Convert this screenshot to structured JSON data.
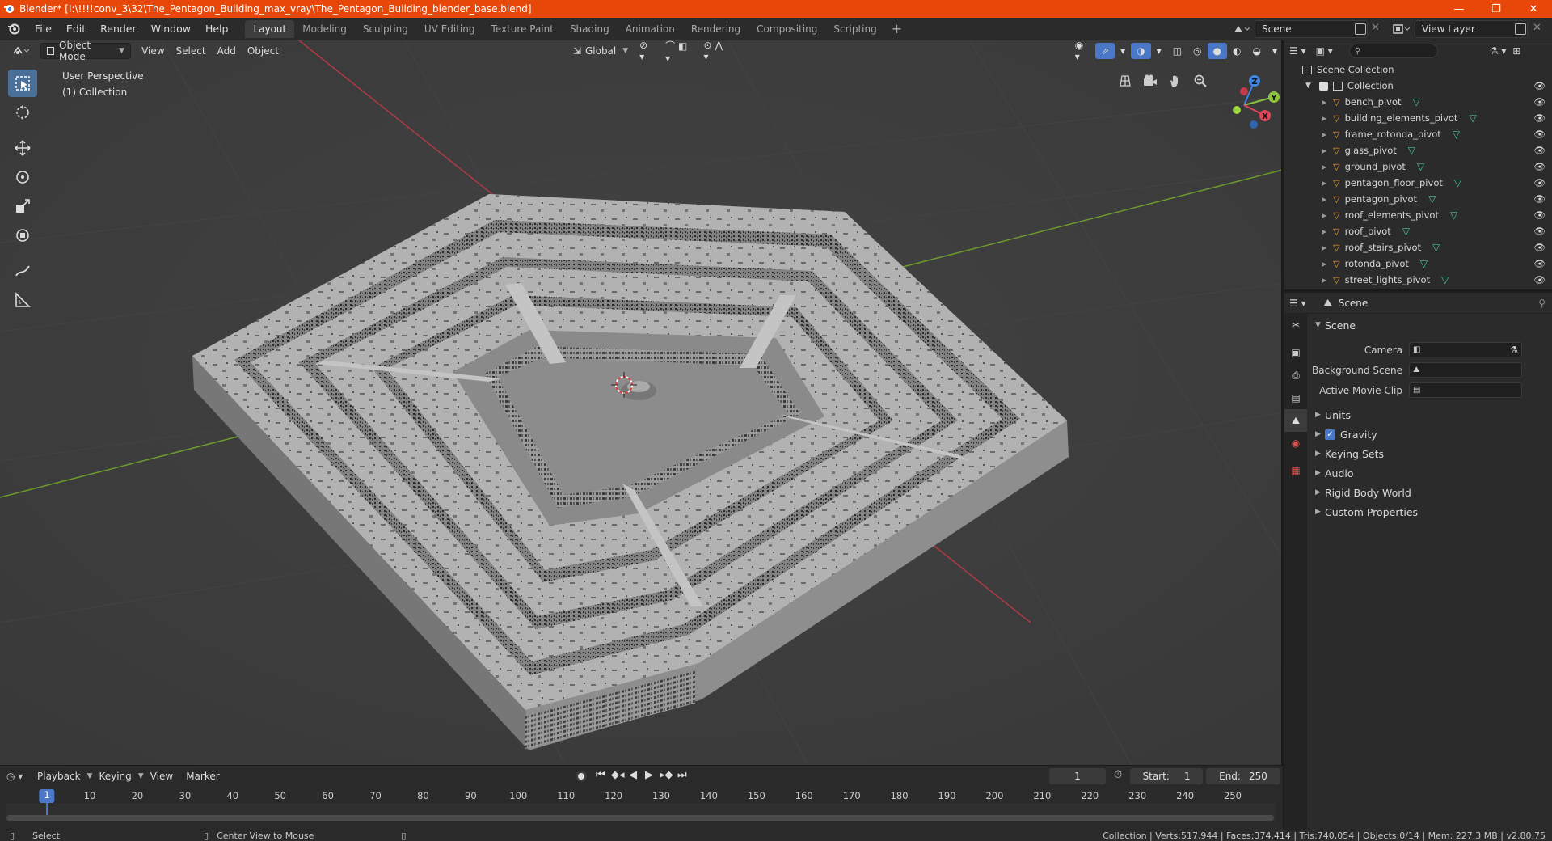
{
  "window": {
    "title": "Blender* [I:\\!!!!conv_3\\32\\The_Pentagon_Building_max_vray\\The_Pentagon_Building_blender_base.blend]",
    "minimize": "—",
    "maximize": "❐",
    "close": "✕"
  },
  "menubar": {
    "items": [
      "File",
      "Edit",
      "Render",
      "Window",
      "Help"
    ],
    "workspaces": [
      "Layout",
      "Modeling",
      "Sculpting",
      "UV Editing",
      "Texture Paint",
      "Shading",
      "Animation",
      "Rendering",
      "Compositing",
      "Scripting"
    ],
    "active_workspace": "Layout",
    "add_workspace": "+",
    "scene": "Scene",
    "view_layer": "View Layer"
  },
  "viewport": {
    "mode": "Object Mode",
    "menus": [
      "View",
      "Select",
      "Add",
      "Object"
    ],
    "orientation": "Global",
    "perspective_label": "User Perspective",
    "collection_label": "(1) Collection",
    "gizmo_axes": {
      "x": "X",
      "y": "Y",
      "z": "Z"
    }
  },
  "timeline": {
    "menus": [
      "Playback",
      "Keying",
      "View",
      "Marker"
    ],
    "current_frame": "1",
    "start_label": "Start:",
    "start": "1",
    "end_label": "End:",
    "end": "250",
    "ticks": [
      "1",
      "10",
      "20",
      "30",
      "40",
      "50",
      "60",
      "70",
      "80",
      "90",
      "100",
      "110",
      "120",
      "130",
      "140",
      "150",
      "160",
      "170",
      "180",
      "190",
      "200",
      "210",
      "220",
      "230",
      "240",
      "250"
    ]
  },
  "statusbar": {
    "select": "Select",
    "center_view": "Center View to Mouse",
    "stats": "Collection | Verts:517,944 | Faces:374,414 | Tris:740,054 | Objects:0/14 | Mem: 227.3 MB | v2.80.75"
  },
  "outliner": {
    "scene_collection": "Scene Collection",
    "collection": "Collection",
    "objects": [
      "bench_pivot",
      "building_elements_pivot",
      "frame_rotonda_pivot",
      "glass_pivot",
      "ground_pivot",
      "pentagon_floor_pivot",
      "pentagon_pivot",
      "roof_elements_pivot",
      "roof_pivot",
      "roof_stairs_pivot",
      "rotonda_pivot",
      "street_lights_pivot"
    ]
  },
  "properties": {
    "context": "Scene",
    "panel_scene": "Scene",
    "fields": [
      {
        "label": "Camera"
      },
      {
        "label": "Background Scene"
      },
      {
        "label": "Active Movie Clip"
      }
    ],
    "panels": [
      "Units",
      "Gravity",
      "Keying Sets",
      "Audio",
      "Rigid Body World",
      "Custom Properties"
    ],
    "gravity_checked": true
  },
  "colors": {
    "titlebar": "#e8470a",
    "accent": "#4a77c7",
    "axis_x": "#e0455a",
    "axis_y": "#8bc33f",
    "axis_z": "#3f86e0",
    "object_icon": "#e79a3b",
    "mesh_icon": "#47c4a0"
  }
}
